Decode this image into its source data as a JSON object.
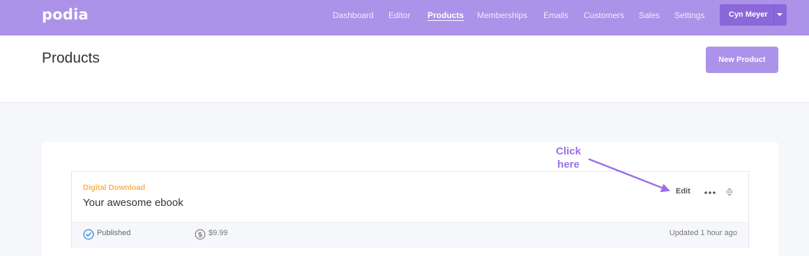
{
  "app": {
    "logo": "podia"
  },
  "nav": {
    "items": [
      {
        "label": "Dashboard",
        "active": false
      },
      {
        "label": "Editor",
        "active": false
      },
      {
        "label": "Products",
        "active": true
      },
      {
        "label": "Memberships",
        "active": false
      },
      {
        "label": "Emails",
        "active": false
      },
      {
        "label": "Customers",
        "active": false
      },
      {
        "label": "Sales",
        "active": false
      },
      {
        "label": "Settings",
        "active": false
      }
    ],
    "user_label": "Cyn Meyer"
  },
  "header": {
    "title": "Products",
    "new_button_label": "New Product"
  },
  "product": {
    "type": "Digital Download",
    "name": "Your awesome ebook",
    "edit_label": "Edit",
    "status": "Published",
    "price": "$9.99",
    "updated": "Updated 1 hour ago"
  },
  "annotation": {
    "line1": "Click",
    "line2": "here"
  },
  "colors": {
    "brand": "#ac92e8",
    "brand_dark": "#8a68d9",
    "type_label": "#f5b35a",
    "annotation": "#9b6ee8"
  }
}
